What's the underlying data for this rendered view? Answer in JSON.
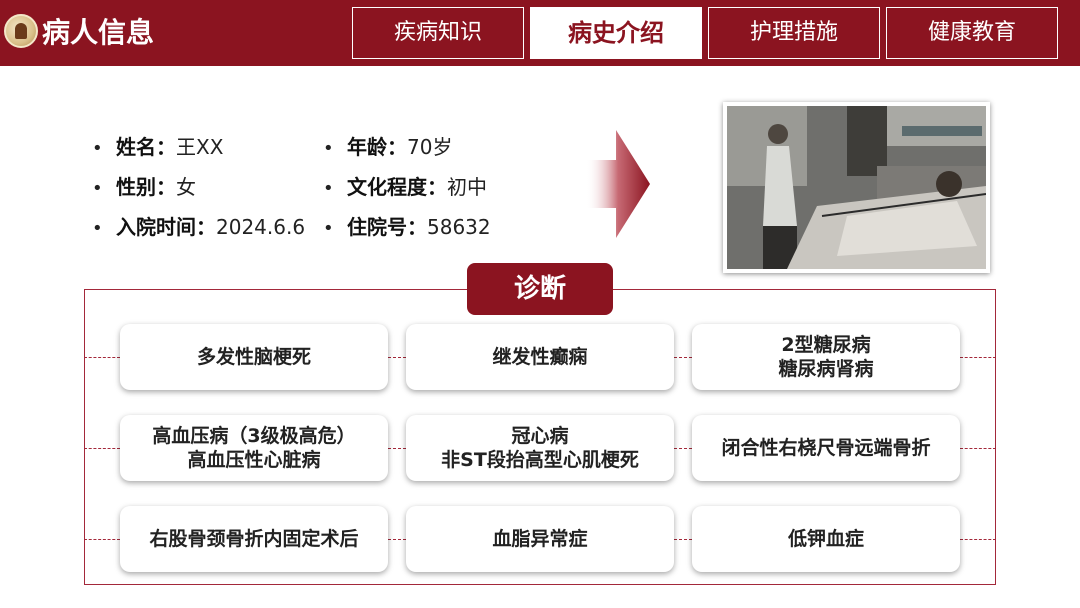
{
  "header": {
    "title": "病人信息",
    "tabs": [
      {
        "label": "疾病知识",
        "active": false
      },
      {
        "label": "病史介绍",
        "active": true
      },
      {
        "label": "护理措施",
        "active": false
      },
      {
        "label": "健康教育",
        "active": false
      }
    ]
  },
  "patient": {
    "bullet": "•",
    "name_label": "姓名：",
    "name": "王XX",
    "age_label": "年龄：",
    "age": "70岁",
    "sex_label": "性别：",
    "sex": "女",
    "education_label": "文化程度：",
    "education": "初中",
    "admission_label": "入院时间：",
    "admission_date": "2024.6.6",
    "inpatient_label": "住院号：",
    "inpatient_no": "58632"
  },
  "diagnosis": {
    "title": "诊断",
    "items": [
      {
        "line1": "多发性脑梗死",
        "line2": ""
      },
      {
        "line1": "继发性癫痫",
        "line2": ""
      },
      {
        "line1": "2型糖尿病",
        "line2": "糖尿病肾病"
      },
      {
        "line1": "高血压病（3级极高危）",
        "line2": "高血压性心脏病"
      },
      {
        "line1": "冠心病",
        "line2": "非ST段抬高型心肌梗死"
      },
      {
        "line1": "闭合性右桡尺骨远端骨折",
        "line2": ""
      },
      {
        "line1": "右股骨颈骨折内固定术后",
        "line2": ""
      },
      {
        "line1": "血脂异常症",
        "line2": ""
      },
      {
        "line1": "低钾血症",
        "line2": ""
      }
    ]
  },
  "colors": {
    "brand": "#8b1420",
    "border": "#a3283a"
  }
}
